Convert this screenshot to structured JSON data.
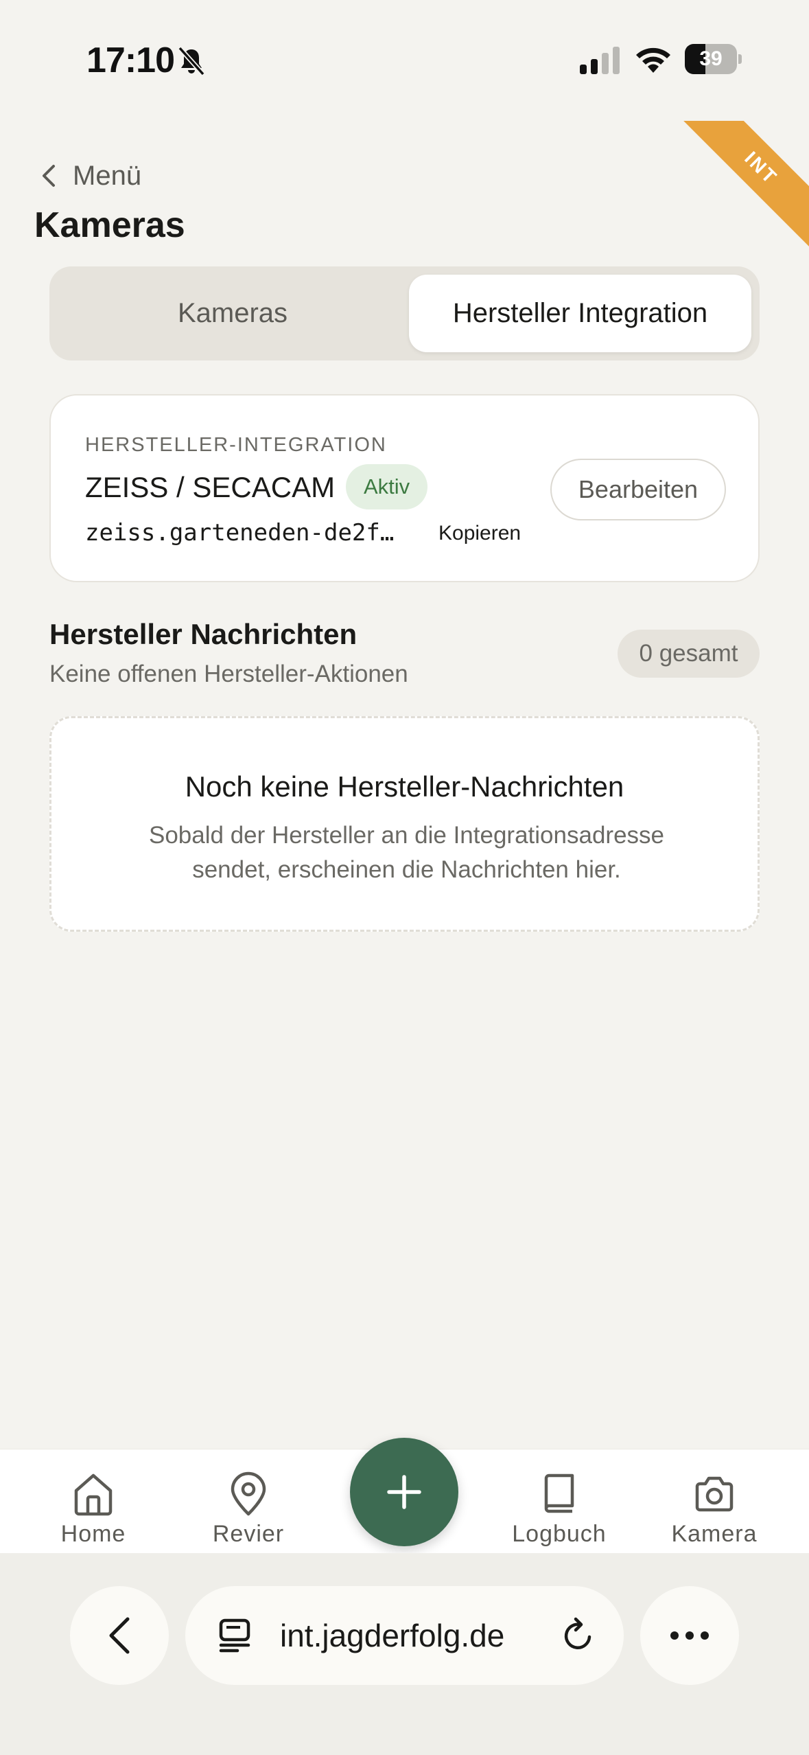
{
  "status_bar": {
    "time": "17:10",
    "battery_level": "39",
    "battery_fraction": 0.39
  },
  "ribbon": {
    "label": "INT",
    "color": "#e8a23c"
  },
  "header": {
    "back_label": "Menü",
    "title": "Kameras"
  },
  "segmented": {
    "tabs": [
      {
        "label": "Kameras",
        "selected": false
      },
      {
        "label": "Hersteller Integration",
        "selected": true
      }
    ]
  },
  "integration_card": {
    "eyebrow": "HERSTELLER-INTEGRATION",
    "brand": "ZEISS / SECACAM",
    "status": "Aktiv",
    "address": "zeiss.garteneden-de2f…",
    "copy_label": "Kopieren",
    "edit_label": "Bearbeiten"
  },
  "messages": {
    "title": "Hersteller Nachrichten",
    "subtitle": "Keine offenen Hersteller-Aktionen",
    "count_label": "0 gesamt",
    "empty_title": "Noch keine Hersteller-Nachrichten",
    "empty_text": "Sobald der Hersteller an die Integrationsadresse sendet, erscheinen die Nachrichten hier."
  },
  "tabbar": {
    "items": [
      {
        "label": "Home",
        "icon": "home-icon"
      },
      {
        "label": "Revier",
        "icon": "map-pin-icon"
      },
      {
        "label": "Logbuch",
        "icon": "book-icon"
      },
      {
        "label": "Kamera",
        "icon": "camera-icon"
      }
    ],
    "fab_icon": "plus-icon",
    "accent": "#3d6b52"
  },
  "browser": {
    "url": "int.jagderfolg.de"
  }
}
